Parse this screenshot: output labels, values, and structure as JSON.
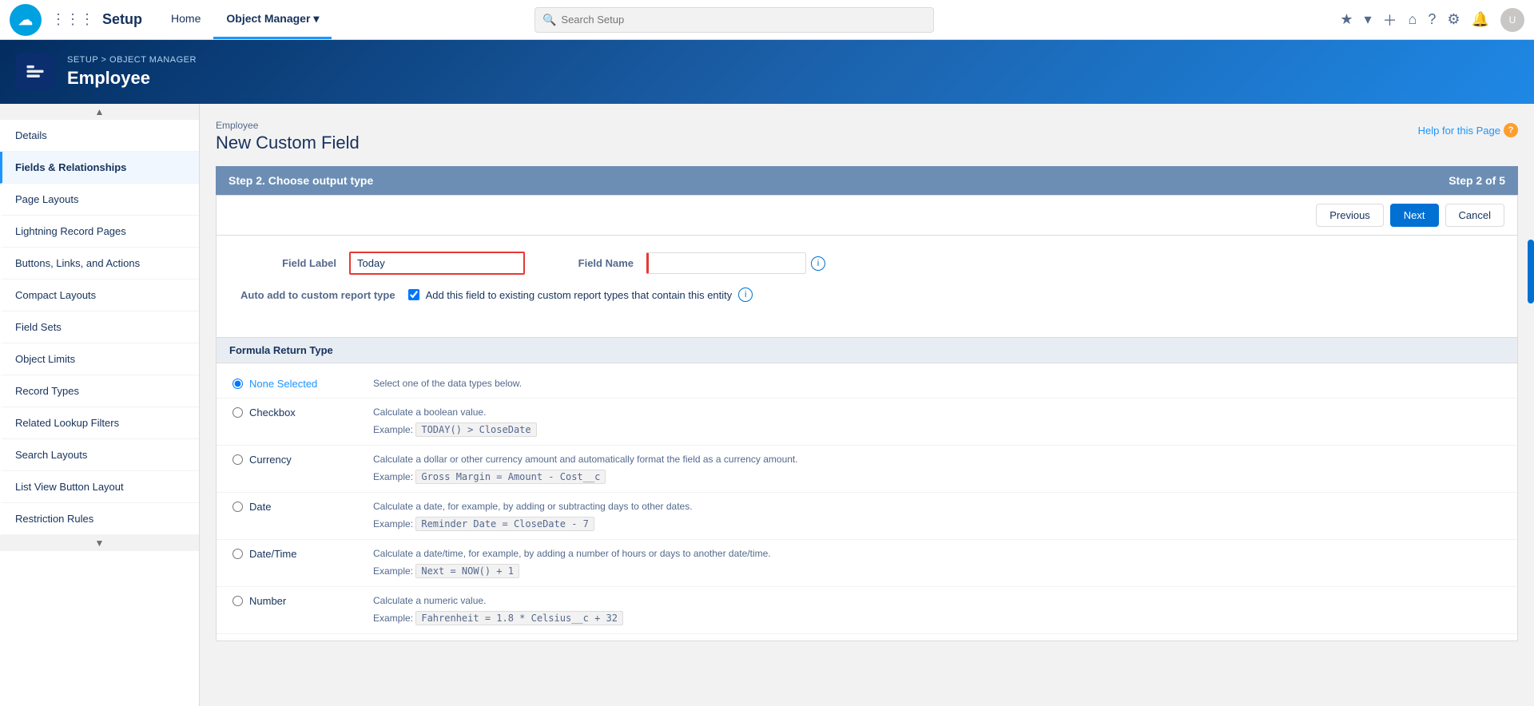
{
  "topNav": {
    "title": "Setup",
    "tabs": [
      {
        "id": "home",
        "label": "Home",
        "active": false
      },
      {
        "id": "objectManager",
        "label": "Object Manager",
        "active": true,
        "hasDropdown": true
      }
    ],
    "search": {
      "placeholder": "Search Setup"
    },
    "actions": {
      "starred": "★",
      "dropdown": "▾",
      "plus": "+",
      "wave": "⌂",
      "question": "?",
      "gear": "⚙",
      "bell": "🔔"
    }
  },
  "headerBanner": {
    "breadcrumb": {
      "setup": "SETUP",
      "separator": ">",
      "objectManager": "OBJECT MANAGER"
    },
    "title": "Employee"
  },
  "sidebar": {
    "items": [
      {
        "id": "details",
        "label": "Details",
        "active": false
      },
      {
        "id": "fields",
        "label": "Fields & Relationships",
        "active": true
      },
      {
        "id": "pageLayouts",
        "label": "Page Layouts",
        "active": false
      },
      {
        "id": "lightningRecordPages",
        "label": "Lightning Record Pages",
        "active": false
      },
      {
        "id": "buttonsLinksActions",
        "label": "Buttons, Links, and Actions",
        "active": false
      },
      {
        "id": "compactLayouts",
        "label": "Compact Layouts",
        "active": false
      },
      {
        "id": "fieldSets",
        "label": "Field Sets",
        "active": false
      },
      {
        "id": "objectLimits",
        "label": "Object Limits",
        "active": false
      },
      {
        "id": "recordTypes",
        "label": "Record Types",
        "active": false
      },
      {
        "id": "relatedLookupFilters",
        "label": "Related Lookup Filters",
        "active": false
      },
      {
        "id": "searchLayouts",
        "label": "Search Layouts",
        "active": false
      },
      {
        "id": "listViewButtonLayout",
        "label": "List View Button Layout",
        "active": false
      },
      {
        "id": "restrictionRules",
        "label": "Restriction Rules",
        "active": false
      }
    ]
  },
  "content": {
    "objectName": "Employee",
    "pageTitle": "New Custom Field",
    "helpLink": "Help for this Page",
    "stepHeader": {
      "title": "Step 2. Choose output type",
      "stepIndicator": "Step 2 of 5"
    },
    "buttons": {
      "previous": "Previous",
      "next": "Next",
      "cancel": "Cancel"
    },
    "form": {
      "fieldLabel": {
        "label": "Field Label",
        "value": "Today"
      },
      "fieldName": {
        "label": "Field Name",
        "value": ""
      },
      "autoAdd": {
        "label": "Auto add to custom report type",
        "checkboxLabel": "Add this field to existing custom report types that contain this entity"
      }
    },
    "formulaSection": {
      "title": "Formula Return Type",
      "options": [
        {
          "id": "noneSelected",
          "label": "None Selected",
          "selected": true,
          "description": "Select one of the data types below.",
          "examples": []
        },
        {
          "id": "checkbox",
          "label": "Checkbox",
          "selected": false,
          "description": "Calculate a boolean value.",
          "exampleLabel": "Example:",
          "exampleCode": "TODAY() > CloseDate"
        },
        {
          "id": "currency",
          "label": "Currency",
          "selected": false,
          "description": "Calculate a dollar or other currency amount and automatically format the field as a currency amount.",
          "exampleLabel": "Example:",
          "exampleCode": "Gross Margin = Amount - Cost__c"
        },
        {
          "id": "date",
          "label": "Date",
          "selected": false,
          "description": "Calculate a date, for example, by adding or subtracting days to other dates.",
          "exampleLabel": "Example:",
          "exampleCode": "Reminder Date = CloseDate - 7"
        },
        {
          "id": "dateTime",
          "label": "Date/Time",
          "selected": false,
          "description": "Calculate a date/time, for example, by adding a number of hours or days to another date/time.",
          "exampleLabel": "Example:",
          "exampleCode": "Next = NOW() + 1"
        },
        {
          "id": "number",
          "label": "Number",
          "selected": false,
          "description": "Calculate a numeric value.",
          "exampleLabel": "Example:",
          "exampleCode": "Fahrenheit = 1.8 * Celsius__c + 32"
        }
      ]
    }
  }
}
